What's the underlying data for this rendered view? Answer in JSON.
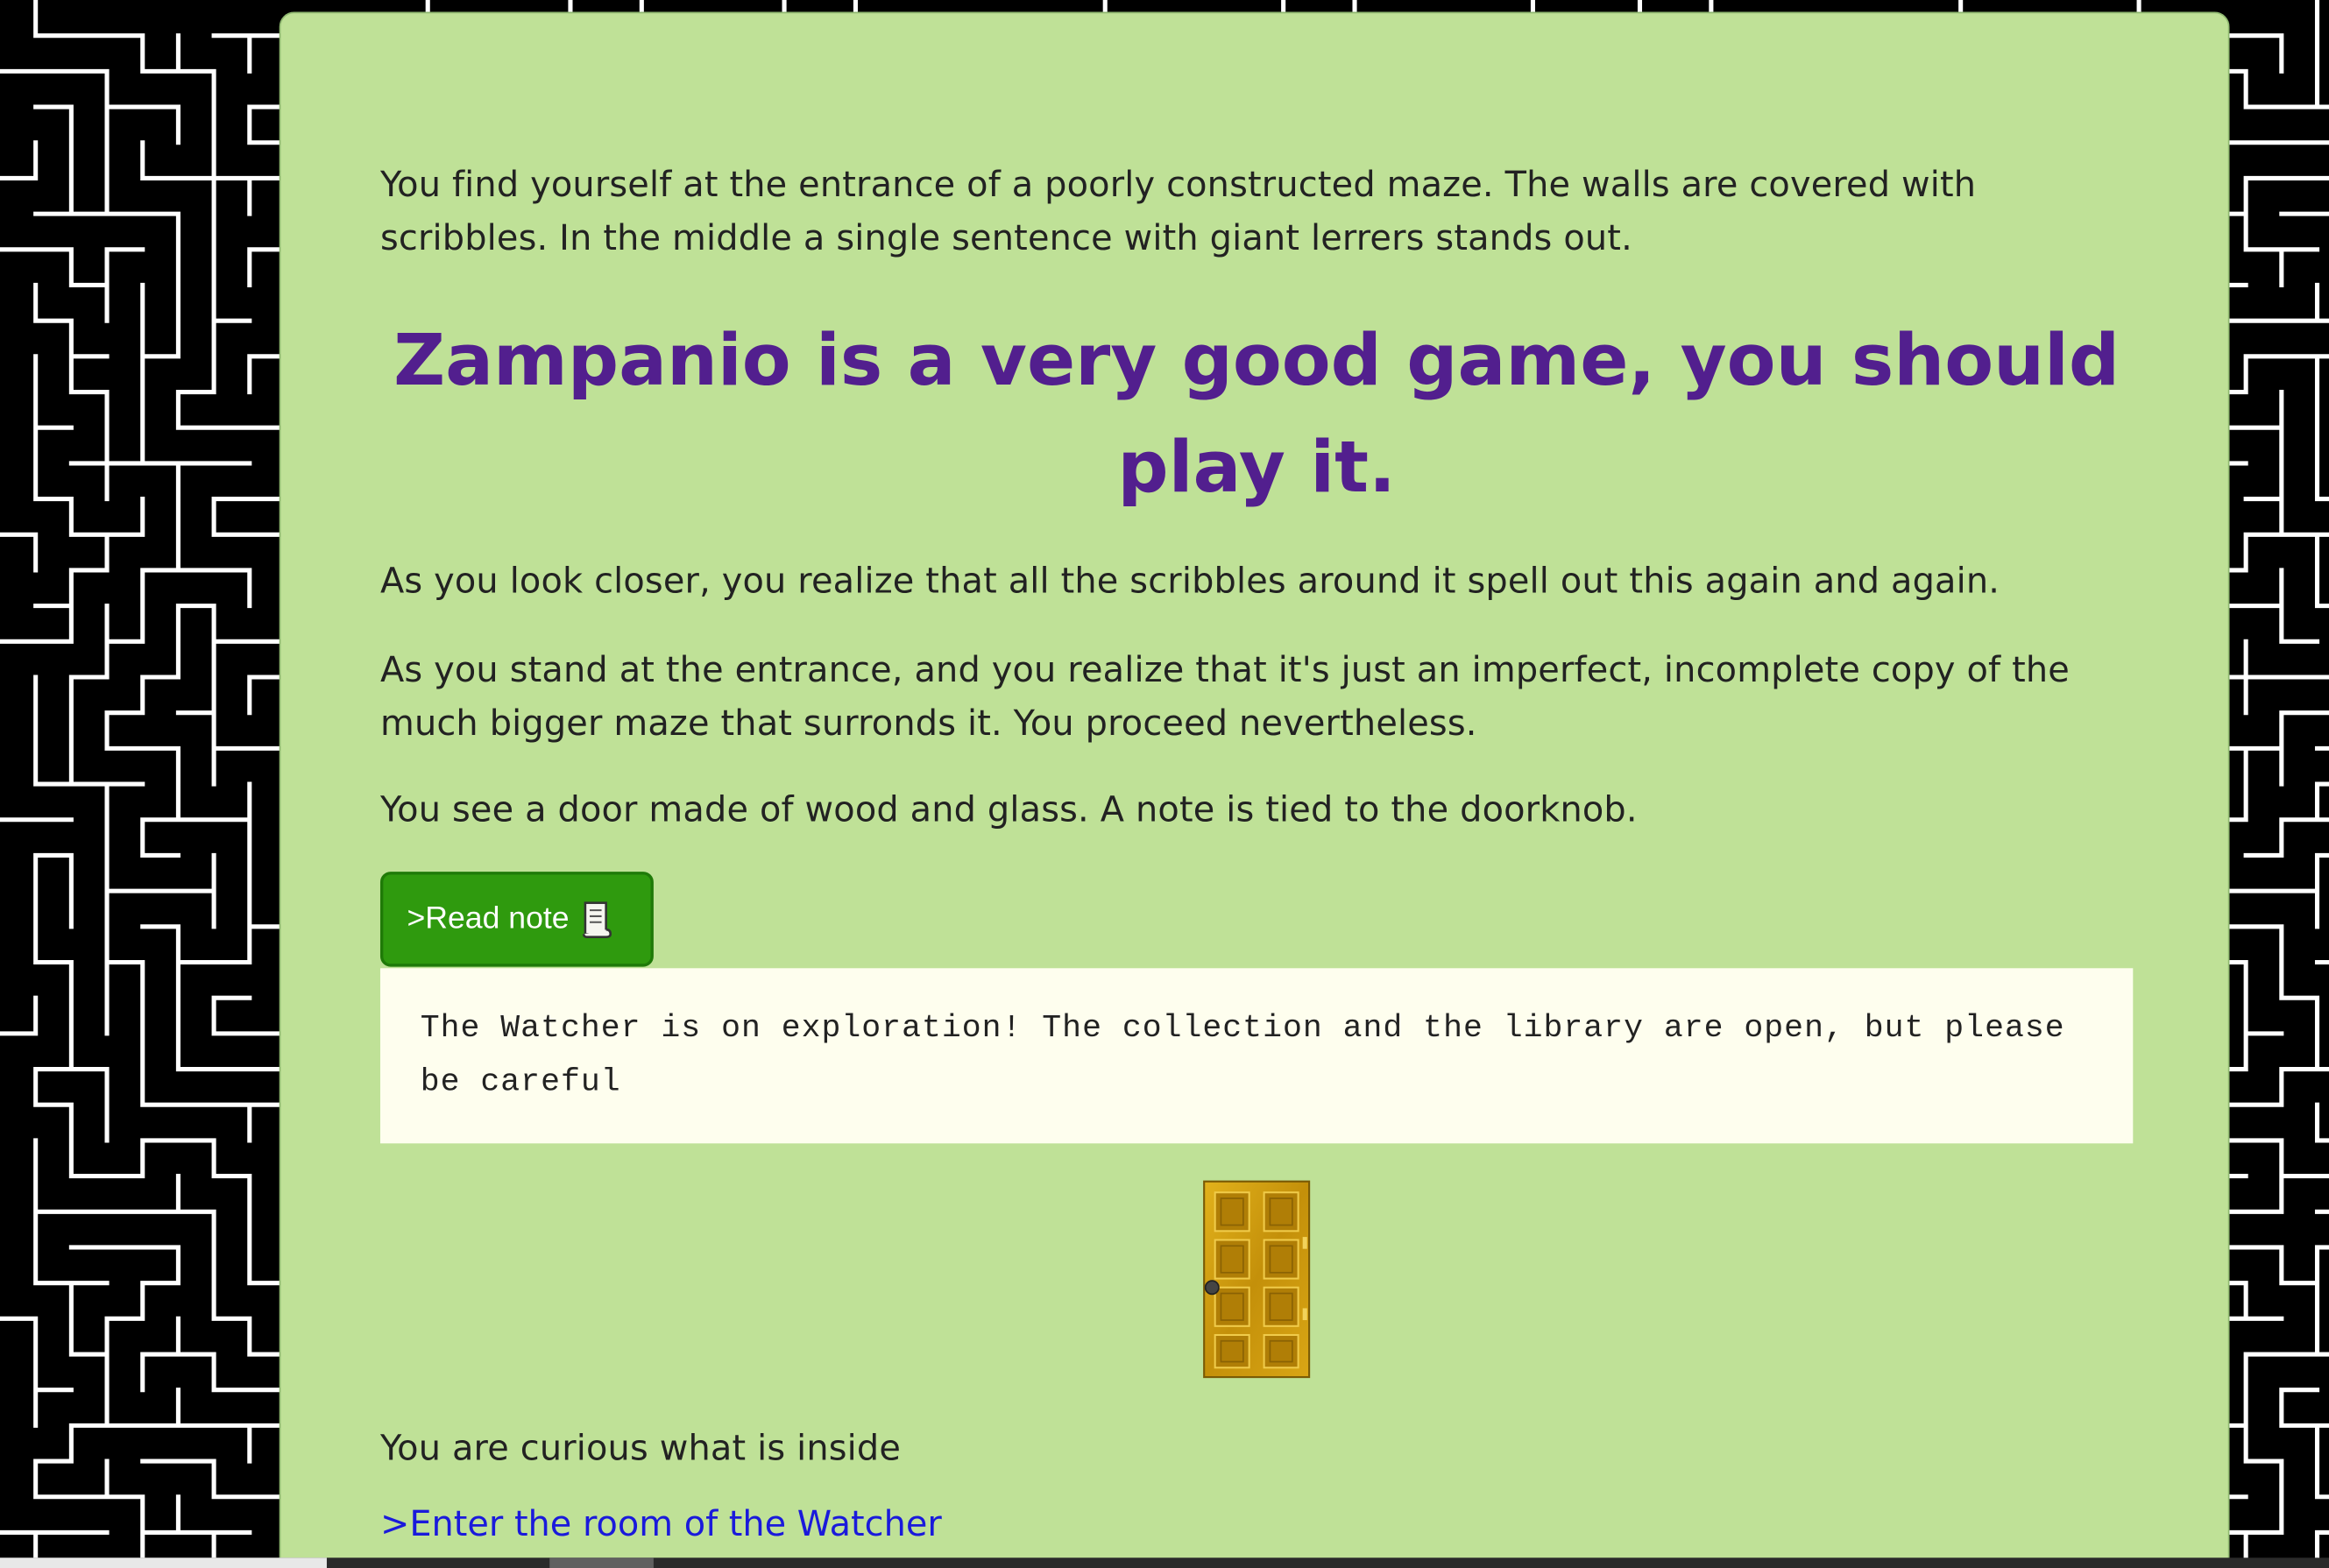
{
  "intro": {
    "paragraph": "You find yourself at the entrance of a poorly constructed maze. The walls are covered with scribbles. In the middle a single sentence with giant lerrers stands out."
  },
  "headline": "Zampanio is a very good game, you should play it.",
  "story": {
    "scribbles": "As you look closer, you realize that all the scribbles around it spell out this again and again.",
    "entrance": "As you stand at the entrance, and you realize that it's just an imperfect, incomplete copy of the much bigger maze that surronds it. You proceed nevertheless.",
    "door": "You see a door made of wood and glass. A note is tied to the doorknob."
  },
  "note_button": {
    "label": ">Read note",
    "icon": "scroll-icon"
  },
  "note": {
    "text": "The Watcher is on exploration! The collection and the library are open, but please be careful"
  },
  "door_image": {
    "icon": "door-icon"
  },
  "curious": "You are curious what is inside",
  "enter_link": ">Enter the room of the Watcher",
  "colors": {
    "panel_bg": "#bfe197",
    "headline": "#521f8e",
    "button_bg": "#2f9a0e",
    "note_bg": "#fefeee",
    "link": "#1a1adb",
    "maze_wall": "#ffffff",
    "maze_bg": "#000000"
  }
}
